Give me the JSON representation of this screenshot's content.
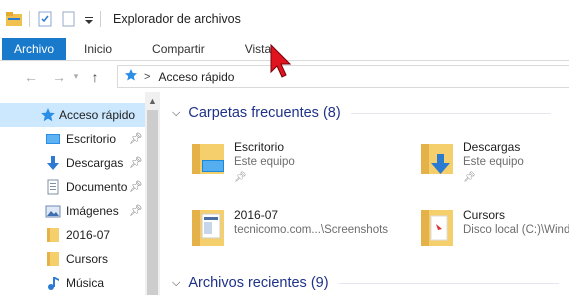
{
  "window": {
    "title": "Explorador de archivos"
  },
  "ribbon": {
    "tabs": [
      "Archivo",
      "Inicio",
      "Compartir",
      "Vista"
    ]
  },
  "address": {
    "path": "Acceso rápido"
  },
  "sidebar": {
    "items": [
      {
        "label": "Acceso rápido",
        "icon": "star-icon",
        "pinned": false,
        "selected": true
      },
      {
        "label": "Escritorio",
        "icon": "desktop-icon",
        "pinned": true
      },
      {
        "label": "Descargas",
        "icon": "download-icon",
        "pinned": true
      },
      {
        "label": "Documentos",
        "icon": "document-icon",
        "pinned": true
      },
      {
        "label": "Imágenes",
        "icon": "pictures-icon",
        "pinned": true
      },
      {
        "label": "2016-07",
        "icon": "folder-icon",
        "pinned": false
      },
      {
        "label": "Cursors",
        "icon": "folder-icon",
        "pinned": false
      },
      {
        "label": "Música",
        "icon": "music-icon",
        "pinned": false
      }
    ]
  },
  "main": {
    "frequent_header": "Carpetas frecuentes (8)",
    "recent_header": "Archivos recientes (9)",
    "folders": [
      {
        "name": "Escritorio",
        "location": "Este equipo",
        "pinned": true,
        "icon": "desktop-folder-icon"
      },
      {
        "name": "Descargas",
        "location": "Este equipo",
        "pinned": true,
        "icon": "downloads-folder-icon"
      },
      {
        "name": "2016-07",
        "location": "tecnicomo.com...\\Screenshots",
        "pinned": false,
        "icon": "folder-icon"
      },
      {
        "name": "Cursors",
        "location": "Disco local (C:)\\Windows",
        "pinned": false,
        "icon": "folder-icon"
      }
    ]
  },
  "colors": {
    "accent": "#1979ca",
    "selected": "#cce8ff",
    "group_header": "#1e3287",
    "folder": "#f5cf6b"
  }
}
